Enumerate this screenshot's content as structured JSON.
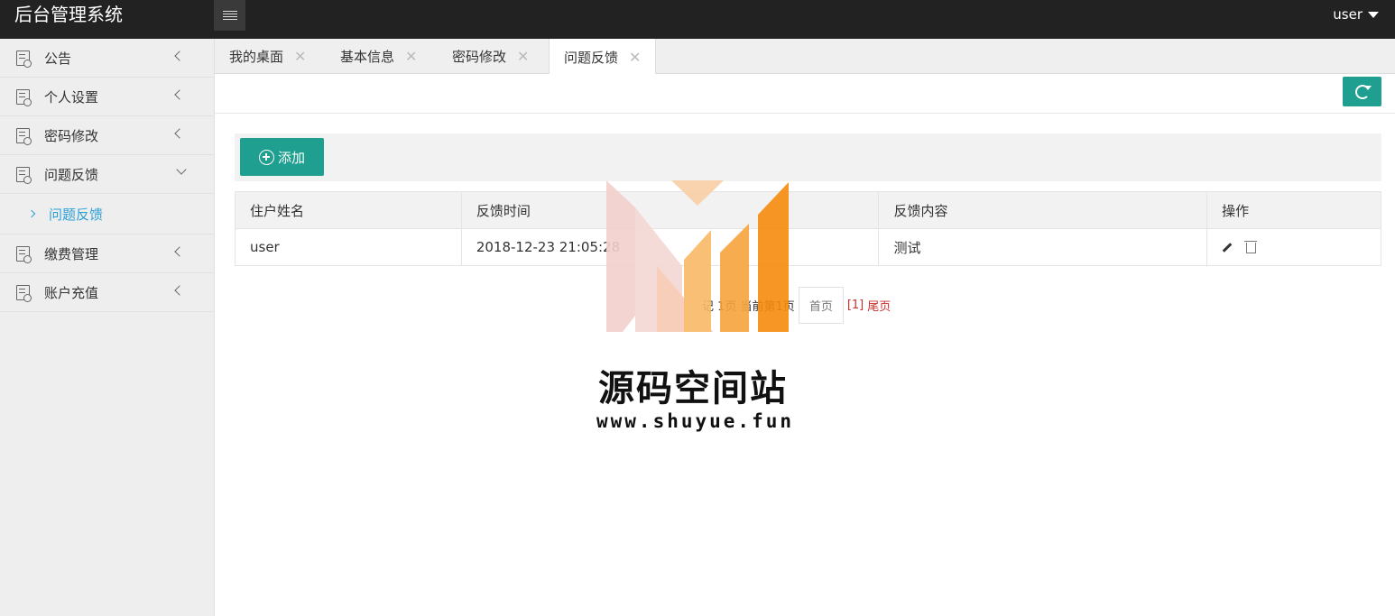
{
  "header": {
    "title": "后台管理系统",
    "user": "user"
  },
  "sidebar": {
    "items": [
      {
        "label": "公告"
      },
      {
        "label": "个人设置"
      },
      {
        "label": "密码修改"
      },
      {
        "label": "问题反馈",
        "expanded": true,
        "sub": "问题反馈"
      },
      {
        "label": "缴费管理"
      },
      {
        "label": "账户充值"
      }
    ]
  },
  "tabs": [
    {
      "label": "我的桌面"
    },
    {
      "label": "基本信息"
    },
    {
      "label": "密码修改"
    },
    {
      "label": "问题反馈",
      "active": true
    }
  ],
  "toolbar": {
    "add_label": "添加"
  },
  "table": {
    "headers": [
      "住户姓名",
      "反馈时间",
      "反馈内容",
      "操作"
    ],
    "rows": [
      {
        "name": "user",
        "time": "2018-12-23 21:05:28",
        "content": "测试"
      }
    ]
  },
  "pager": {
    "info": "记   1页 当前第1页",
    "first": "首页",
    "num": "[1]",
    "last": "尾页"
  },
  "watermark": {
    "title": "源码空间站",
    "url": "www.shuyue.fun"
  },
  "colors": {
    "accent": "#1e9f8f",
    "header": "#222222",
    "link": "#2a9fd6",
    "pager": "#c9302c"
  }
}
